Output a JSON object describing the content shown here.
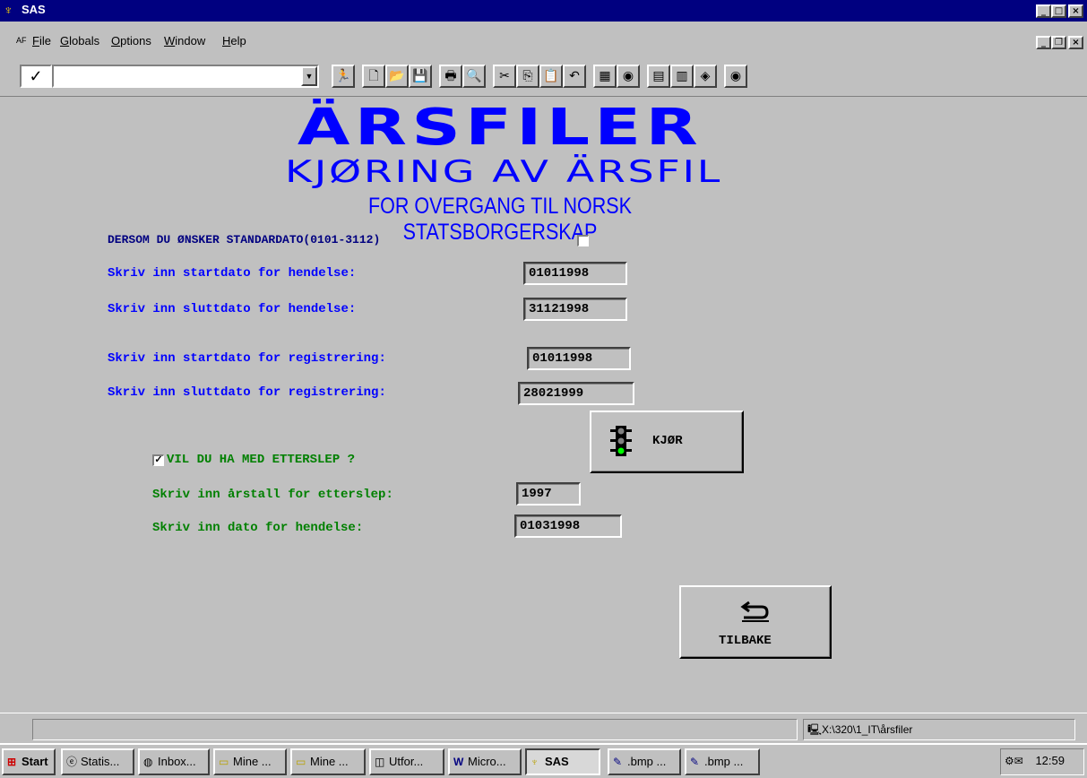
{
  "window": {
    "title": "SAS",
    "icon": "sas-logo-icon"
  },
  "menubar": {
    "af_label": "AF",
    "items": [
      {
        "label": "File",
        "underline": "F"
      },
      {
        "label": "Globals",
        "underline": "G"
      },
      {
        "label": "Options",
        "underline": "O"
      },
      {
        "label": "Window",
        "underline": "W"
      },
      {
        "label": "Help",
        "underline": "H"
      }
    ]
  },
  "toolbar": {
    "command_value": "",
    "buttons": [
      "checkmark-icon",
      "run-icon",
      "new-icon",
      "open-icon",
      "save-icon",
      "print-icon",
      "print-preview-icon",
      "cut-icon",
      "copy-icon",
      "paste-icon",
      "undo-icon",
      "ms-office-icon",
      "globe-icon",
      "report-icon",
      "table-icon",
      "book-icon",
      "globe-icon"
    ]
  },
  "form": {
    "title": "ÄRSFILER",
    "subtitle": "KJØRING AV ÄRSFIL",
    "subtitle2": "FOR OVERGANG TIL NORSK STATSBORGERSKAP",
    "standard_date_label": "DERSOM DU ØNSKER STANDARDATO(0101-3112)",
    "standard_date_checked": false,
    "start_event_label": "Skriv inn startdato for hendelse:",
    "start_event_value": "01011998",
    "end_event_label": "Skriv inn sluttdato for hendelse:",
    "end_event_value": "31121998",
    "start_reg_label": "Skriv inn startdato for registrering:",
    "start_reg_value": "01011998",
    "end_reg_label": "Skriv inn sluttdato for registrering:",
    "end_reg_value": "28021999",
    "lag_checkbox_label": "VIL DU HA MED ETTERSLEP ?",
    "lag_checked": true,
    "lag_year_label": "Skriv inn årstall for etterslep:",
    "lag_year_value": "1997",
    "event_date_label": "Skriv inn dato for hendelse:",
    "event_date_value": "01031998",
    "run_button": "KJØR",
    "back_button": "TILBAKE"
  },
  "statusbar": {
    "path": "X:\\320\\1_IT\\årsfiler"
  },
  "taskbar": {
    "start": "Start",
    "tasks": [
      {
        "label": "Statis...",
        "icon": "ie-icon"
      },
      {
        "label": "Inbox...",
        "icon": "inbox-icon"
      },
      {
        "label": "Mine ...",
        "icon": "folder-icon"
      },
      {
        "label": "Mine ...",
        "icon": "folder-icon"
      },
      {
        "label": "Utfor...",
        "icon": "explorer-icon"
      },
      {
        "label": "Micro...",
        "icon": "word-icon"
      },
      {
        "label": "SAS",
        "icon": "sas-logo-icon"
      },
      {
        "label": ".bmp ...",
        "icon": "paint-icon"
      },
      {
        "label": ".bmp ...",
        "icon": "paint-icon"
      }
    ],
    "clock": "12:59"
  }
}
